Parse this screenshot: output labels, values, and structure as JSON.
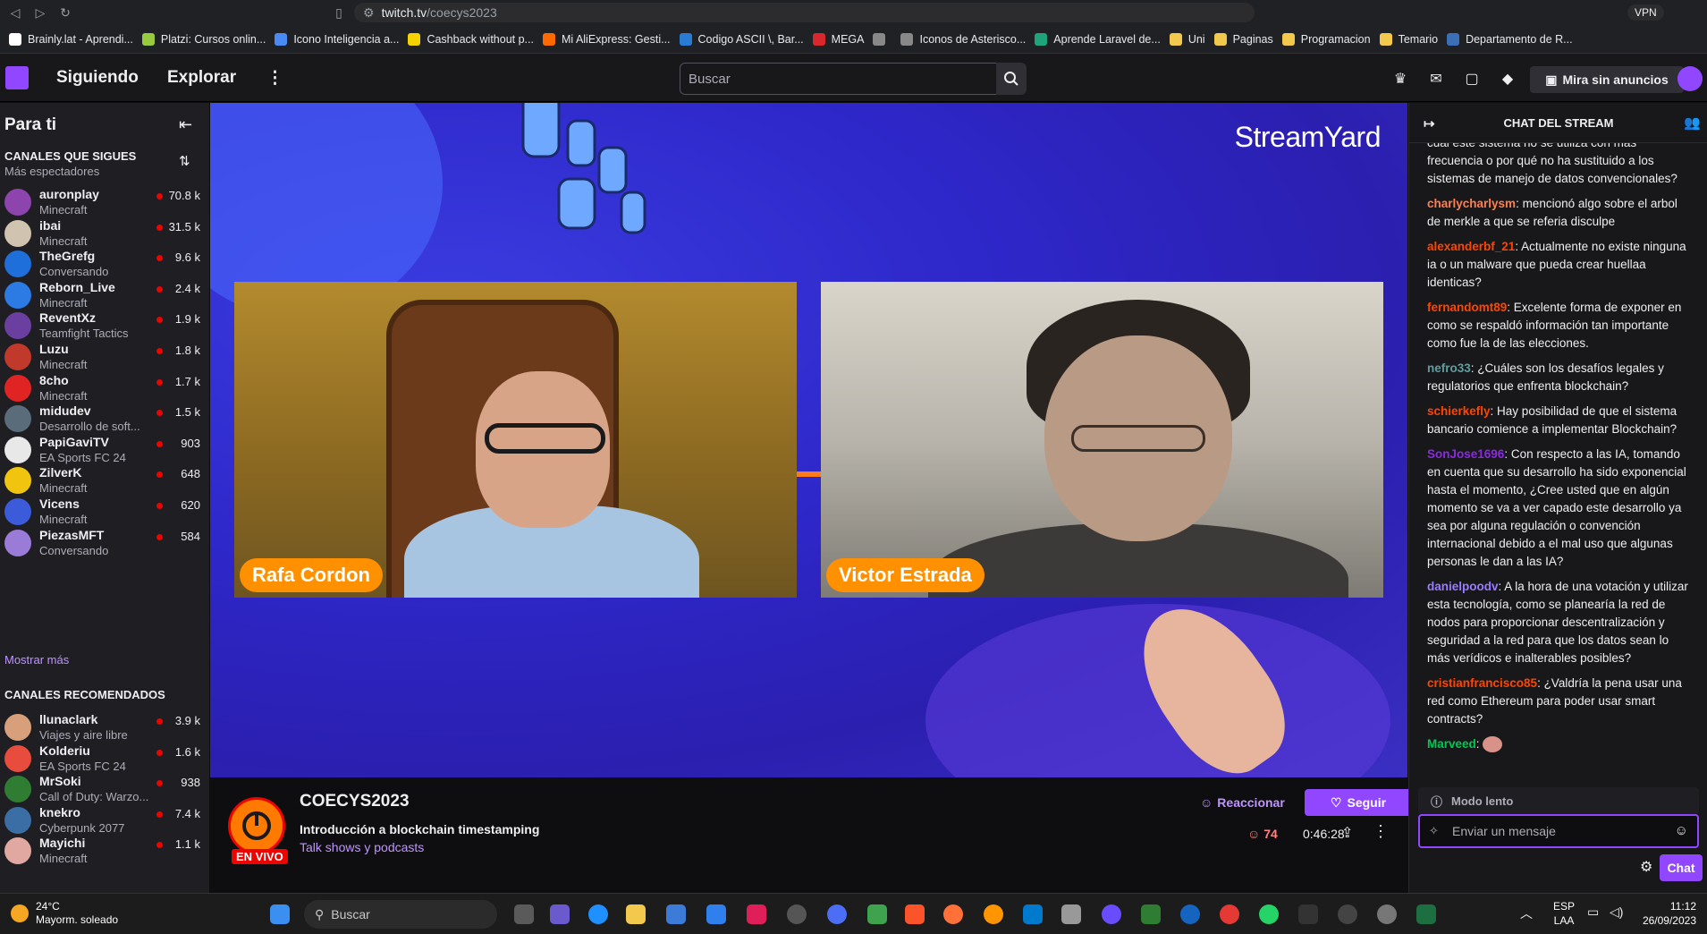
{
  "browser": {
    "url_host": "twitch.tv",
    "url_path": "/coecys2023",
    "vpn_label": "VPN",
    "bookmarks": [
      {
        "label": "Brainly.lat - Aprendi...",
        "color": "#ffffff"
      },
      {
        "label": "Platzi: Cursos onlin...",
        "color": "#98ca3f"
      },
      {
        "label": "Icono Inteligencia a...",
        "color": "#4a8af4"
      },
      {
        "label": "Cashback without p...",
        "color": "#f5d300"
      },
      {
        "label": "Mi AliExpress: Gesti...",
        "color": "#ff6a00"
      },
      {
        "label": "Codigo ASCII \\, Bar...",
        "color": "#2a7bd4"
      },
      {
        "label": "MEGA",
        "color": "#d9272e"
      },
      {
        "label": "",
        "color": "#888888"
      },
      {
        "label": "Iconos de Asterisco...",
        "color": "#888888"
      },
      {
        "label": "Aprende Laravel de...",
        "color": "#1fa37b"
      },
      {
        "label": "Uni",
        "color": "#f2c94c"
      },
      {
        "label": "Paginas",
        "color": "#f2c94c"
      },
      {
        "label": "Programacion",
        "color": "#f2c94c"
      },
      {
        "label": "Temario",
        "color": "#f2c94c"
      },
      {
        "label": "Departamento de R...",
        "color": "#3b6fb6"
      }
    ]
  },
  "topnav": {
    "following": "Siguiendo",
    "browse": "Explorar",
    "search_placeholder": "Buscar",
    "noads": "Mira sin anuncios"
  },
  "sidebar": {
    "title": "Para ti",
    "followed_title": "CANALES QUE SIGUES",
    "followed_sub": "Más espectadores",
    "show_more": "Mostrar más",
    "recommended_title": "CANALES RECOMENDADOS",
    "followed": [
      {
        "name": "auronplay",
        "game": "Minecraft",
        "viewers": "70.8 k",
        "color": "#8e44ad"
      },
      {
        "name": "ibai",
        "game": "Minecraft",
        "viewers": "31.5 k",
        "color": "#d0c4b0"
      },
      {
        "name": "TheGrefg",
        "game": "Conversando",
        "viewers": "9.6 k",
        "color": "#1e6fd9"
      },
      {
        "name": "Reborn_Live",
        "game": "Minecraft",
        "viewers": "2.4 k",
        "color": "#2c7be5"
      },
      {
        "name": "ReventXz",
        "game": "Teamfight Tactics",
        "viewers": "1.9 k",
        "color": "#6b3fa0"
      },
      {
        "name": "Luzu",
        "game": "Minecraft",
        "viewers": "1.8 k",
        "color": "#c0392b"
      },
      {
        "name": "8cho",
        "game": "Minecraft",
        "viewers": "1.7 k",
        "color": "#e02424"
      },
      {
        "name": "midudev",
        "game": "Desarrollo de soft...",
        "viewers": "1.5 k",
        "color": "#5a6b7a"
      },
      {
        "name": "PapiGaviTV",
        "game": "EA Sports FC 24",
        "viewers": "903",
        "color": "#e8e8e8"
      },
      {
        "name": "ZilverK",
        "game": "Minecraft",
        "viewers": "648",
        "color": "#f1c40f"
      },
      {
        "name": "Vicens",
        "game": "Minecraft",
        "viewers": "620",
        "color": "#3b5bdb"
      },
      {
        "name": "PiezasMFT",
        "game": "Conversando",
        "viewers": "584",
        "color": "#9b7bd8"
      }
    ],
    "recommended": [
      {
        "name": "llunaclark",
        "game": "Viajes y aire libre",
        "viewers": "3.9 k",
        "color": "#d8a07a"
      },
      {
        "name": "Kolderiu",
        "game": "EA Sports FC 24",
        "viewers": "1.6 k",
        "color": "#e74c3c"
      },
      {
        "name": "MrSoki",
        "game": "Call of Duty: Warzo...",
        "viewers": "938",
        "color": "#2e7d32"
      },
      {
        "name": "knekro",
        "game": "Cyberpunk 2077",
        "viewers": "7.4 k",
        "color": "#3a6ea5"
      },
      {
        "name": "Mayichi",
        "game": "Minecraft",
        "viewers": "1.1 k",
        "color": "#e0a8a0"
      }
    ]
  },
  "video": {
    "brand": "StreamYard",
    "cam1_name": "Rafa Cordon",
    "cam2_name": "Victor Estrada"
  },
  "stream_info": {
    "channel": "COECYS2023",
    "live": "EN VIVO",
    "title": "Introducción a blockchain timestamping",
    "category": "Talk shows y podcasts",
    "react": "Reaccionar",
    "follow": "Seguir",
    "viewers": "74",
    "uptime": "0:46:28"
  },
  "chat": {
    "title": "CHAT DEL STREAM",
    "messages": [
      {
        "user": "",
        "color": "#efeff1",
        "text": "cual este sistema no se utiliza con más frecuencia o por qué no ha sustituido a los sistemas de manejo de datos convencionales?"
      },
      {
        "user": "charlycharlysm",
        "color": "#ff7f50",
        "text": ": mencionó algo sobre el arbol de merkle a que se referia disculpe"
      },
      {
        "user": "alexanderbf_21",
        "color": "#ff4500",
        "text": ": Actualmente no existe ninguna ia o un malware que pueda crear huellaa identicas?"
      },
      {
        "user": "fernandomt89",
        "color": "#ff4500",
        "text": ": Excelente forma de exponer en como se respaldó información tan importante como fue la de las elecciones."
      },
      {
        "user": "nefro33",
        "color": "#5f9ea0",
        "text": ": ¿Cuáles son los desafíos legales y regulatorios que enfrenta blockchain?"
      },
      {
        "user": "schierkefly",
        "color": "#ff4500",
        "text": ": Hay posibilidad de que el sistema bancario comience a implementar Blockchain?"
      },
      {
        "user": "SonJose1696",
        "color": "#8a2be2",
        "text": ": Con respecto a las IA, tomando en cuenta que su desarrollo ha sido exponencial hasta el momento, ¿Cree usted que en algún momento se va a ver capado este desarrollo ya sea por alguna regulación o convención internacional debido a el mal uso que algunas personas le dan a las IA?"
      },
      {
        "user": "danielpoodv",
        "color": "#9b7bff",
        "text": ": A la hora de una votación y utilizar esta tecnología, como se planearía la red de nodos para proporcionar descentralización y seguridad a la red para que los datos sean lo más verídicos e inalterables posibles?"
      },
      {
        "user": "cristianfrancisco85",
        "color": "#ff4500",
        "text": ": ¿Valdría la pena usar una red como Ethereum para poder usar smart contracts?"
      },
      {
        "user": "Marveed",
        "color": "#00c853",
        "text": ": "
      }
    ],
    "slow_mode": "Modo lento",
    "input_placeholder": "Enviar un mensaje",
    "send": "Chat"
  },
  "taskbar": {
    "temp": "24°C",
    "weather": "Mayorm. soleado",
    "search": "Buscar",
    "lang1": "ESP",
    "lang2": "LAA",
    "time": "11:12",
    "date": "26/09/2023"
  }
}
